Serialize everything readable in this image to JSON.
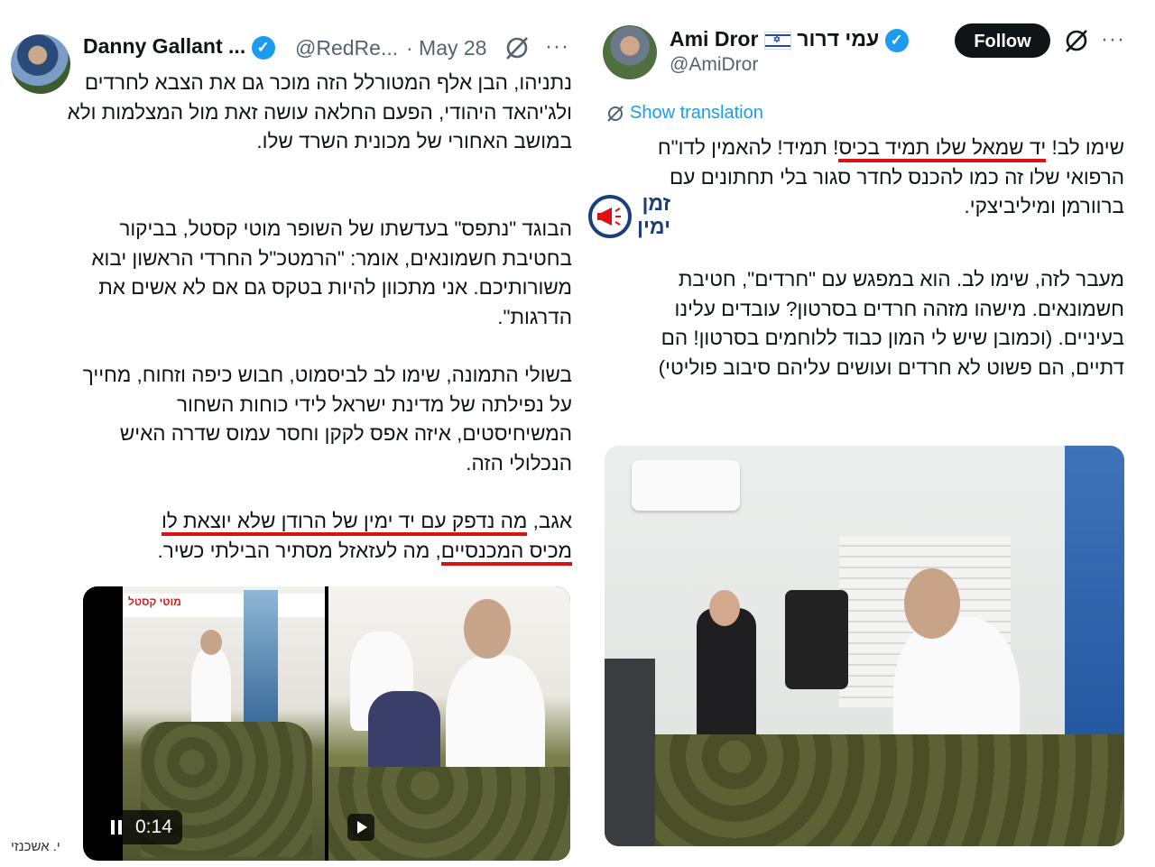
{
  "left_tweet": {
    "author_name": "Danny Gallant ...",
    "handle": "@RedRe...",
    "date": "· May 28",
    "more": "···",
    "paragraphs": [
      "נתניהו, הבן אלף המטורלל הזה מוכר גם את הצבא לחרדים ולג'יהאד היהודי, הפעם החלאה עושה זאת מול המצלמות ולא במושב האחורי של מכונית השרד שלו.",
      "הבוגד \"נתפס\" בעדשתו של השופר מוטי קסטל, בביקור בחטיבת חשמונאים, אומר: \"הרמטכ\"ל החרדי הראשון יבוא משורותיכם. אני מתכוון להיות בטקס גם אם לא אשים את הדרגות\".",
      "בשולי התמונה, שימו לב לביסמוט, חבוש כיפה וזחוח, מחייך על נפילתה של מדינת ישראל לידי כוחות השחור המשיחיסטים, איזה אפס לקקן וחסר עמוס שדרה האיש הנכלולי הזה."
    ],
    "last_paragraph": {
      "prefix": "אגב, ",
      "underlined_1": "מה נדפק עם יד ימין של הרודן שלא יוצאת לו",
      "line2_underlined": "מכיס המכנסיים",
      "suffix": ", מה לעזאזל מסתיר הבילתי כשיר."
    },
    "video": {
      "watermark": "מוטי קסטל",
      "time": "0:14"
    },
    "credit": "י. אשכנזי"
  },
  "right_tweet": {
    "author_name": "Ami Dror",
    "author_name_he": "עמי דרור",
    "handle": "@AmiDror",
    "follow_label": "Follow",
    "more": "···",
    "show_translation": "Show translation",
    "p1_prefix": "שימו לב! ",
    "p1_underlined": "יד שמאל שלו תמיד בכיס",
    "p1_rest": "! תמיד! להאמין לדו\"ח הרפואי שלו זה כמו להכנס לחדר סגור בלי תחתונים עם ברוורמן ומיליביצקי.",
    "p2": "מעבר לזה, שימו לב. הוא במפגש עם \"חרדים\", חטיבת חשמונאים. מישהו מזהה חרדים בסרטון? עובדים עלינו בעיניים. (וכמובן שיש לי המון כבוד ללוחמים בסרטון! הם דתיים, הם פשוט לא חרדים ועושים עליהם סיבוב פוליטי)",
    "logo": {
      "line1": "זמן",
      "line2": "ימין"
    }
  },
  "colors": {
    "text": "#0f1419",
    "secondary": "#536471",
    "link": "#1d9bf0",
    "verified": "#1d9bf0",
    "underline": "#dd1111",
    "logo": "#1c3f79"
  }
}
